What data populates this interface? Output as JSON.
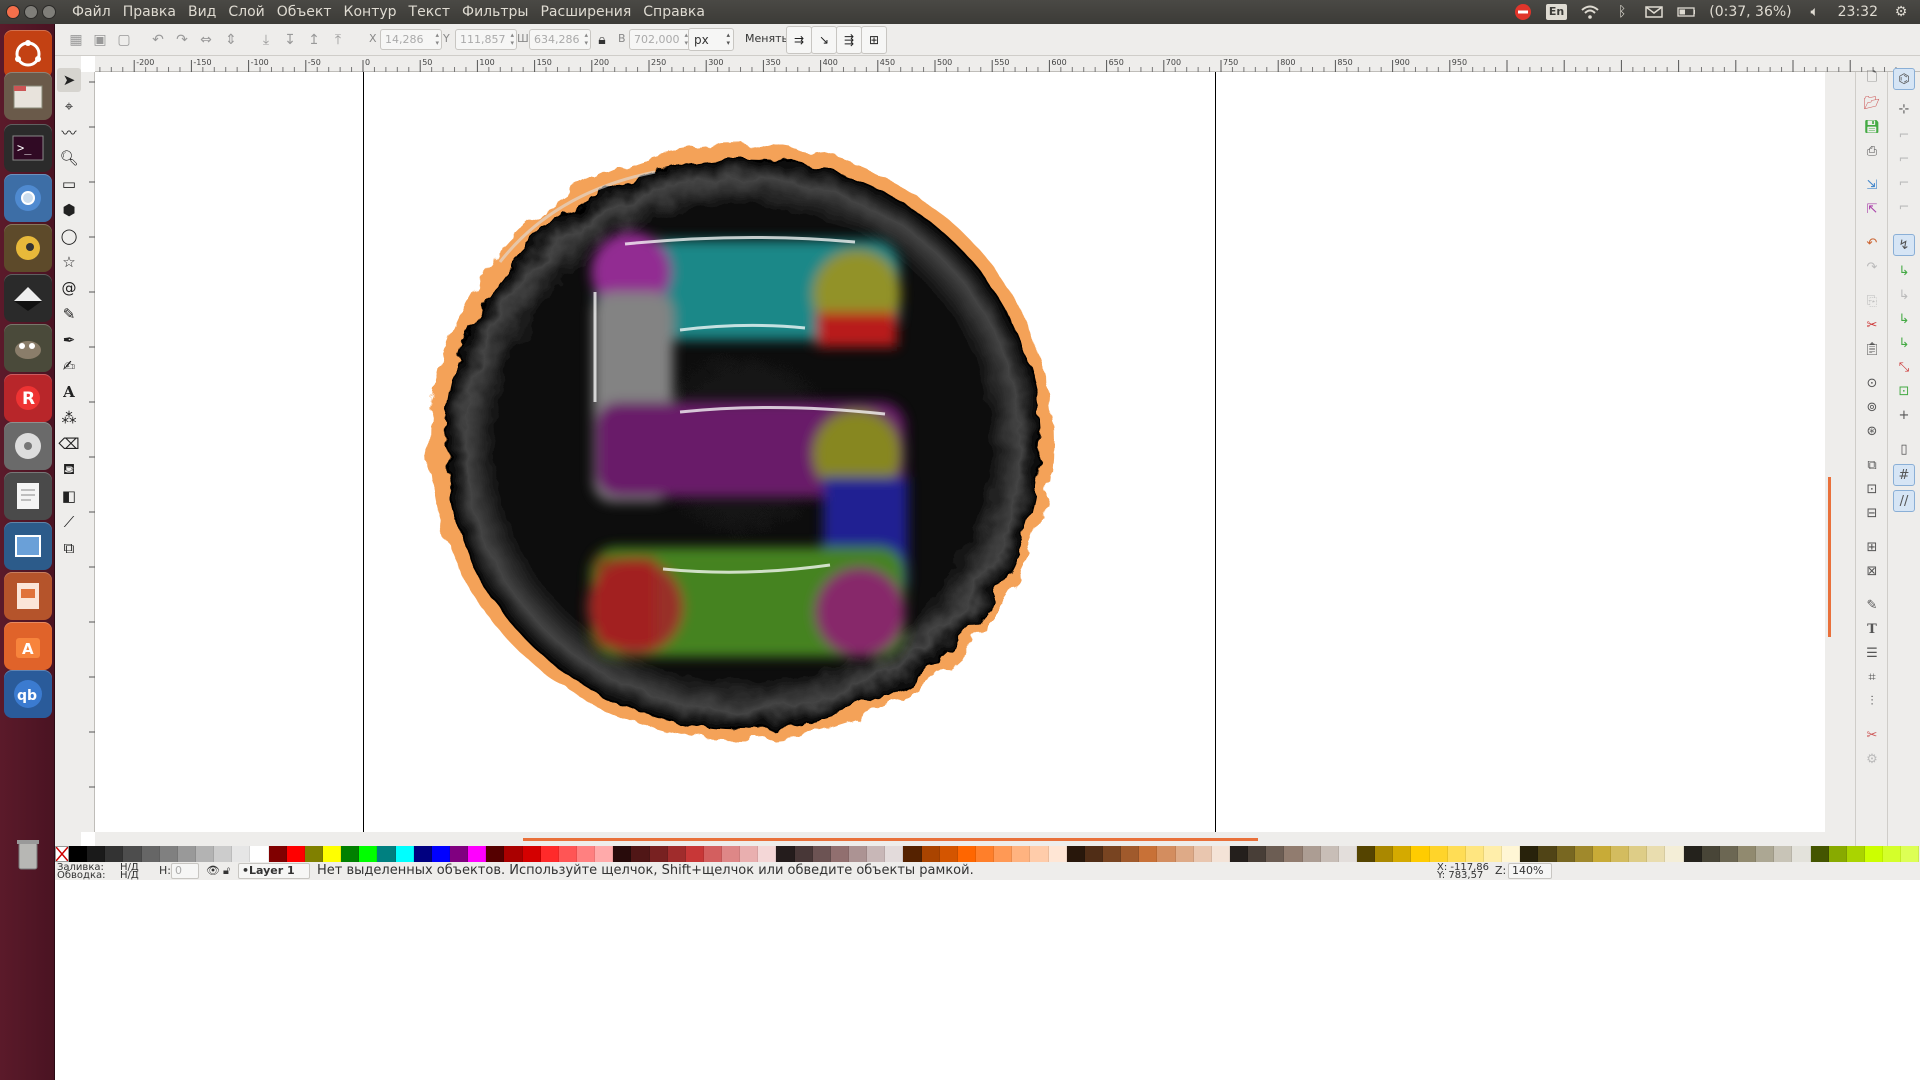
{
  "menu": [
    "Файл",
    "Правка",
    "Вид",
    "Слой",
    "Объект",
    "Контур",
    "Текст",
    "Фильтры",
    "Расширения",
    "Справка"
  ],
  "indicators": {
    "lang": "En",
    "battery": "(0:37, 36%)",
    "time": "23:32"
  },
  "toolbar": {
    "x_label": "X",
    "x_value": "14,286",
    "y_label": "Y",
    "y_value": "111,857",
    "w_label": "Ш",
    "w_value": "634,286",
    "h_label": "В",
    "h_value": "702,000",
    "unit": "px",
    "change_label": "Менять:"
  },
  "ruler_ticks": [
    "-200",
    "-150",
    "-100",
    "-50",
    "0",
    "50",
    "100",
    "150",
    "200",
    "250",
    "300",
    "350",
    "400",
    "450",
    "500",
    "550",
    "600",
    "650",
    "700",
    "750",
    "800",
    "850",
    "900",
    "950"
  ],
  "status": {
    "fill_label": "Заливка:",
    "fill_value": "Н/Д",
    "stroke_label": "Обводка:",
    "stroke_value": "Н/Д",
    "opacity_label": "Н:",
    "opacity_value": "0",
    "layer": "•Layer 1",
    "message": "Нет выделенных объектов. Используйте щелчок, Shift+щелчок или обведите объекты рамкой.",
    "cursor_x": "X: -117,86",
    "cursor_y": "Y: 783,57",
    "zoom_label": "Z:",
    "zoom": "140%"
  },
  "palette": [
    "#000000",
    "#1a1a1a",
    "#333333",
    "#4d4d4d",
    "#666666",
    "#808080",
    "#999999",
    "#b3b3b3",
    "#cccccc",
    "#e6e6e6",
    "#ffffff",
    "#800000",
    "#ff0000",
    "#808000",
    "#ffff00",
    "#008000",
    "#00ff00",
    "#008080",
    "#00ffff",
    "#000080",
    "#0000ff",
    "#800080",
    "#ff00ff",
    "#550000",
    "#aa0000",
    "#d40000",
    "#ff2a2a",
    "#ff5555",
    "#ff8080",
    "#ffaaaa",
    "#280b0b",
    "#501616",
    "#782121",
    "#a02c2c",
    "#c83737",
    "#d35f5f",
    "#de8787",
    "#e9afaf",
    "#f4d7d7",
    "#241c1c",
    "#483737",
    "#6c5353",
    "#916f6f",
    "#ac9393",
    "#c8b7b7",
    "#e3dbdb",
    "#552200",
    "#aa4400",
    "#d45500",
    "#ff6600",
    "#ff7f2a",
    "#ff9955",
    "#ffb380",
    "#ffccaa",
    "#ffe6d5",
    "#28170b",
    "#502d16",
    "#784421",
    "#a05a2c",
    "#c87137",
    "#d38d5f",
    "#deaa87",
    "#e9c6af",
    "#f4e3d7",
    "#241f1c",
    "#483e37",
    "#6c5d53",
    "#917c6f",
    "#ac9d93",
    "#c8beb7",
    "#e3dedb",
    "#554400",
    "#aa8800",
    "#d4aa00",
    "#ffcc00",
    "#ffd42a",
    "#ffdd55",
    "#ffe680",
    "#ffeeaa",
    "#fff6d5",
    "#28220b",
    "#504416",
    "#786721",
    "#a0892c",
    "#c8ab37",
    "#d3bc5f",
    "#decd87",
    "#e9ddaf",
    "#f4eed7",
    "#24221c",
    "#484537",
    "#6c6753",
    "#918a6f",
    "#aca793",
    "#c8c4b7",
    "#e3e2db",
    "#445500",
    "#88aa00",
    "#aad400",
    "#ccff00",
    "#d4ff2a",
    "#ddff55"
  ],
  "colors": {
    "accent": "#e9703a",
    "panel": "#3c3b37",
    "launcher": "#5b1a2a"
  }
}
